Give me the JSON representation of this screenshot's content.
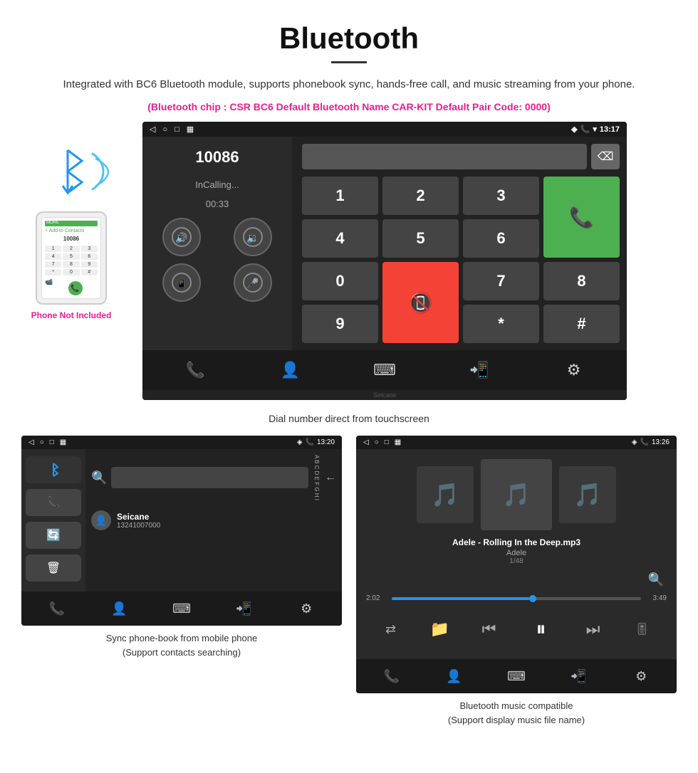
{
  "header": {
    "title": "Bluetooth",
    "description": "Integrated with BC6 Bluetooth module, supports phonebook sync, hands-free call, and music streaming from your phone.",
    "specs": "(Bluetooth chip : CSR BC6    Default Bluetooth Name CAR-KIT    Default Pair Code: 0000)"
  },
  "phone_aside": {
    "not_included": "Phone Not Included"
  },
  "dial_screen": {
    "status_time": "13:17",
    "dial_number": "10086",
    "in_calling": "InCalling...",
    "timer": "00:33",
    "keys": [
      "1",
      "2",
      "3",
      "*",
      "4",
      "5",
      "6",
      "0",
      "7",
      "8",
      "9",
      "#"
    ]
  },
  "dial_caption": "Dial number direct from touchscreen",
  "phonebook_screen": {
    "status_time": "13:20",
    "contact_name": "Seicane",
    "contact_number": "13241007000",
    "alpha": "A B C D E F G H I"
  },
  "phonebook_caption1": "Sync phone-book from mobile phone",
  "phonebook_caption2": "(Support contacts searching)",
  "music_screen": {
    "status_time": "13:26",
    "song_title": "Adele - Rolling In the Deep.mp3",
    "artist": "Adele",
    "count": "1/48",
    "current_time": "2:02",
    "total_time": "3:49"
  },
  "music_caption1": "Bluetooth music compatible",
  "music_caption2": "(Support display music file name)"
}
